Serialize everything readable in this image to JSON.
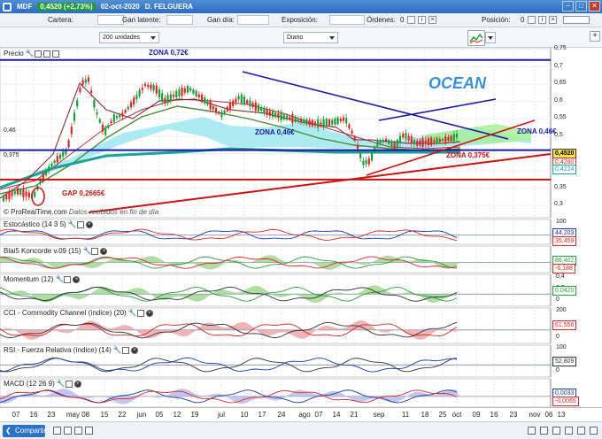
{
  "titlebar": {
    "symbol": "MDF",
    "price": "0,4520 (+2,73%)",
    "date": "02-oct-2020",
    "name": "D. FELGUERA"
  },
  "infobar": {
    "cartera": "Cartera:",
    "latente": "Gan latente:",
    "dia": "Gan día:",
    "exposicion": "Exposición:",
    "ordenes": "Órdenes:",
    "ordenes_val": "0",
    "posicion": "Posición:",
    "posicion_val": "0"
  },
  "toolbar": {
    "units": "200 unidades",
    "period": "Diario"
  },
  "main_panel": {
    "label": "Precio",
    "footer": "© ProRealTime.com",
    "footer_note": "Datos recibidos en fin de día",
    "texts": {
      "zona_072": "ZONA 0,72€",
      "ocean": "OCEAN",
      "zona_046_mid": "ZONA 0,46€",
      "zona_046_right": "ZONA 0,46€",
      "zona_0375": "ZONA 0,375€",
      "gap": "GAP 0,2665€",
      "left_046": "0,46",
      "left_0375": "0,375"
    },
    "yaxis": [
      "0,75",
      "0,7",
      "0,65",
      "0,6",
      "0,55",
      "0,5",
      "0,45",
      "0,4",
      "0,35",
      "0,3"
    ],
    "tags": {
      "price": "0,4520",
      "t1": "0,4280",
      "t2": "0,4224"
    }
  },
  "indicators": [
    {
      "name": "Estocástico (14 3 5)",
      "axis": [
        "100",
        "0"
      ],
      "tags": [
        "44,203",
        "35,459"
      ]
    },
    {
      "name": "Blai5 Koncorde v.09 (15)",
      "axis": [],
      "tags": [
        "86,402",
        "-6,188"
      ]
    },
    {
      "name": "Momentum (12)",
      "axis": [
        "0,4",
        "0,2",
        "0"
      ],
      "tags": [
        "0,0420"
      ]
    },
    {
      "name": "CCI - Commodity Channel (índice) (20)",
      "axis": [
        "200",
        "0"
      ],
      "tags": [
        "61,556"
      ]
    },
    {
      "name": "RSI - Fuerza Relativa (índice) (14)",
      "axis": [
        "100",
        "0"
      ],
      "tags": [
        "52,809"
      ]
    },
    {
      "name": "MACD (12 26 9)",
      "axis": [
        "0"
      ],
      "tags": [
        "0,0033",
        "-0,0065"
      ]
    }
  ],
  "dates": [
    "07",
    "16",
    "23",
    "may 08",
    "15",
    "22",
    "jun",
    "05",
    "12",
    "19",
    "jul",
    "10",
    "17",
    "24",
    "ago",
    "07",
    "14",
    "21",
    "sep",
    "11",
    "18",
    "25",
    "oct",
    "09",
    "16",
    "23",
    "nov",
    "06",
    "13"
  ],
  "statusbar": {
    "share": "Compartir"
  },
  "colors": {
    "up": "#1d9d3a",
    "down": "#d62828",
    "zone_blue": "#1a1aa8",
    "zone_red": "#cc1111",
    "cloud_cyan": "#8fe4ec",
    "cloud_green": "#a8ee9a"
  }
}
